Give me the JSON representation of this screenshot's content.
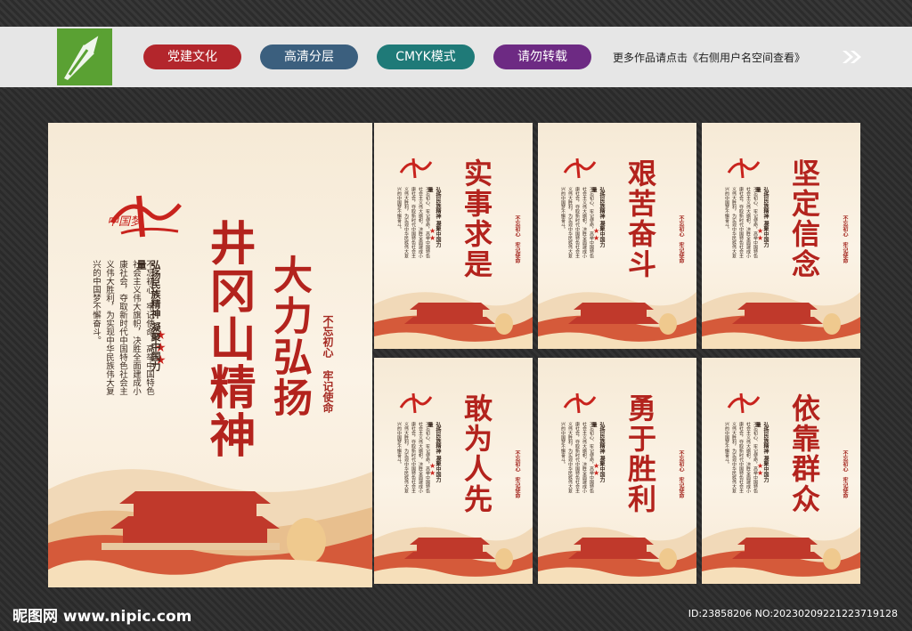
{
  "header": {
    "tags": [
      {
        "label": "党建文化",
        "color": "#b3262c"
      },
      {
        "label": "高清分层",
        "color": "#3b5f7e"
      },
      {
        "label": "CMYK模式",
        "color": "#1f7a78"
      },
      {
        "label": "请勿转载",
        "color": "#6d2a83"
      }
    ],
    "more_text": "更多作品请点击《右侧用户名空间查看》"
  },
  "main_poster": {
    "title": "井冈山精神",
    "subtitle": "大力弘扬",
    "slogan_a": "不忘初心",
    "slogan_b": "牢记使命",
    "tagline": "弘扬民族精神  凝聚中国力量",
    "body": "不忘初心、牢记使命，高举中国特色社会主义伟大旗帜，决胜全面建成小康社会，夺取新时代中国特色社会主义伟大胜利，为实现中华民族伟大复兴的中国梦不懈奋斗。",
    "logo_text": "中国梦"
  },
  "small_posters": [
    {
      "title": "实事求是"
    },
    {
      "title": "艰苦奋斗"
    },
    {
      "title": "坚定信念"
    },
    {
      "title": "敢为人先"
    },
    {
      "title": "勇于胜利"
    },
    {
      "title": "依靠群众"
    }
  ],
  "footer": {
    "site": "昵图网 www.nipic.com",
    "id": "ID:23858206 NO:20230209221223719128"
  },
  "colors": {
    "accent_red": "#b3231d",
    "logo_green": "#5aa133"
  }
}
